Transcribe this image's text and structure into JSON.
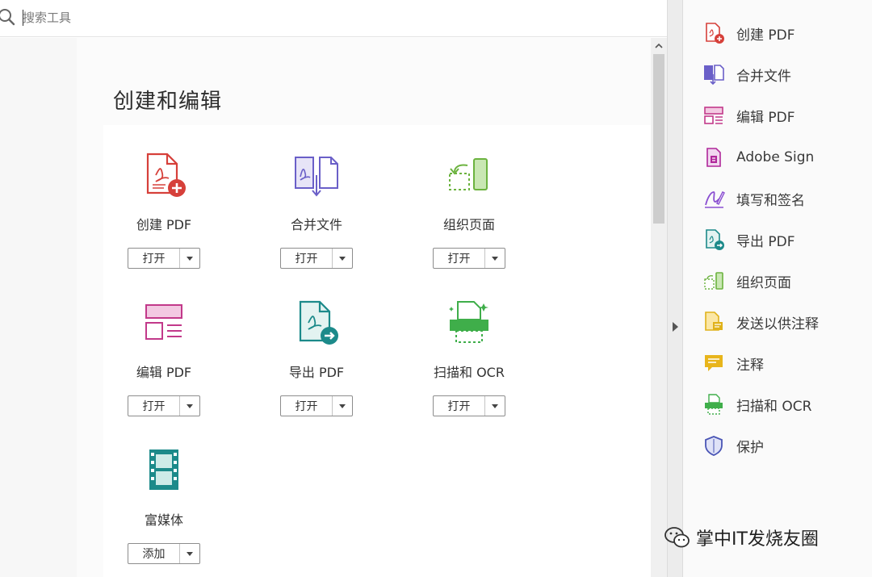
{
  "search": {
    "placeholder": "搜索工具",
    "icon": "search-icon"
  },
  "main": {
    "section_title": "创建和编辑",
    "tools": [
      {
        "label": "创建 PDF",
        "button": "打开",
        "icon": "create-pdf-icon",
        "color": "#d6403a"
      },
      {
        "label": "合并文件",
        "button": "打开",
        "icon": "combine-files-icon",
        "color": "#6a5fc8"
      },
      {
        "label": "组织页面",
        "button": "打开",
        "icon": "organize-pages-icon",
        "color": "#6cb33f"
      },
      {
        "label": "编辑 PDF",
        "button": "打开",
        "icon": "edit-pdf-icon",
        "color": "#c2398a"
      },
      {
        "label": "导出 PDF",
        "button": "打开",
        "icon": "export-pdf-icon",
        "color": "#1c8a8a"
      },
      {
        "label": "扫描和 OCR",
        "button": "打开",
        "icon": "scan-ocr-icon",
        "color": "#3fae4a"
      },
      {
        "label": "富媒体",
        "button": "添加",
        "icon": "rich-media-icon",
        "color": "#1c8a8a"
      }
    ]
  },
  "right_pane": {
    "items": [
      {
        "label": "创建 PDF",
        "icon": "create-pdf-icon"
      },
      {
        "label": "合并文件",
        "icon": "combine-files-icon"
      },
      {
        "label": "编辑 PDF",
        "icon": "edit-pdf-icon"
      },
      {
        "label": "Adobe Sign",
        "icon": "adobe-sign-icon"
      },
      {
        "label": "填写和签名",
        "icon": "fill-sign-icon"
      },
      {
        "label": "导出 PDF",
        "icon": "export-pdf-icon"
      },
      {
        "label": "组织页面",
        "icon": "organize-pages-icon"
      },
      {
        "label": "发送以供注释",
        "icon": "send-for-comments-icon"
      },
      {
        "label": "注释",
        "icon": "comment-icon"
      },
      {
        "label": "扫描和 OCR",
        "icon": "scan-ocr-icon"
      },
      {
        "label": "保护",
        "icon": "protect-icon"
      }
    ]
  },
  "watermark": {
    "text": "掌中IT发烧友圈",
    "icon": "wechat-icon"
  }
}
